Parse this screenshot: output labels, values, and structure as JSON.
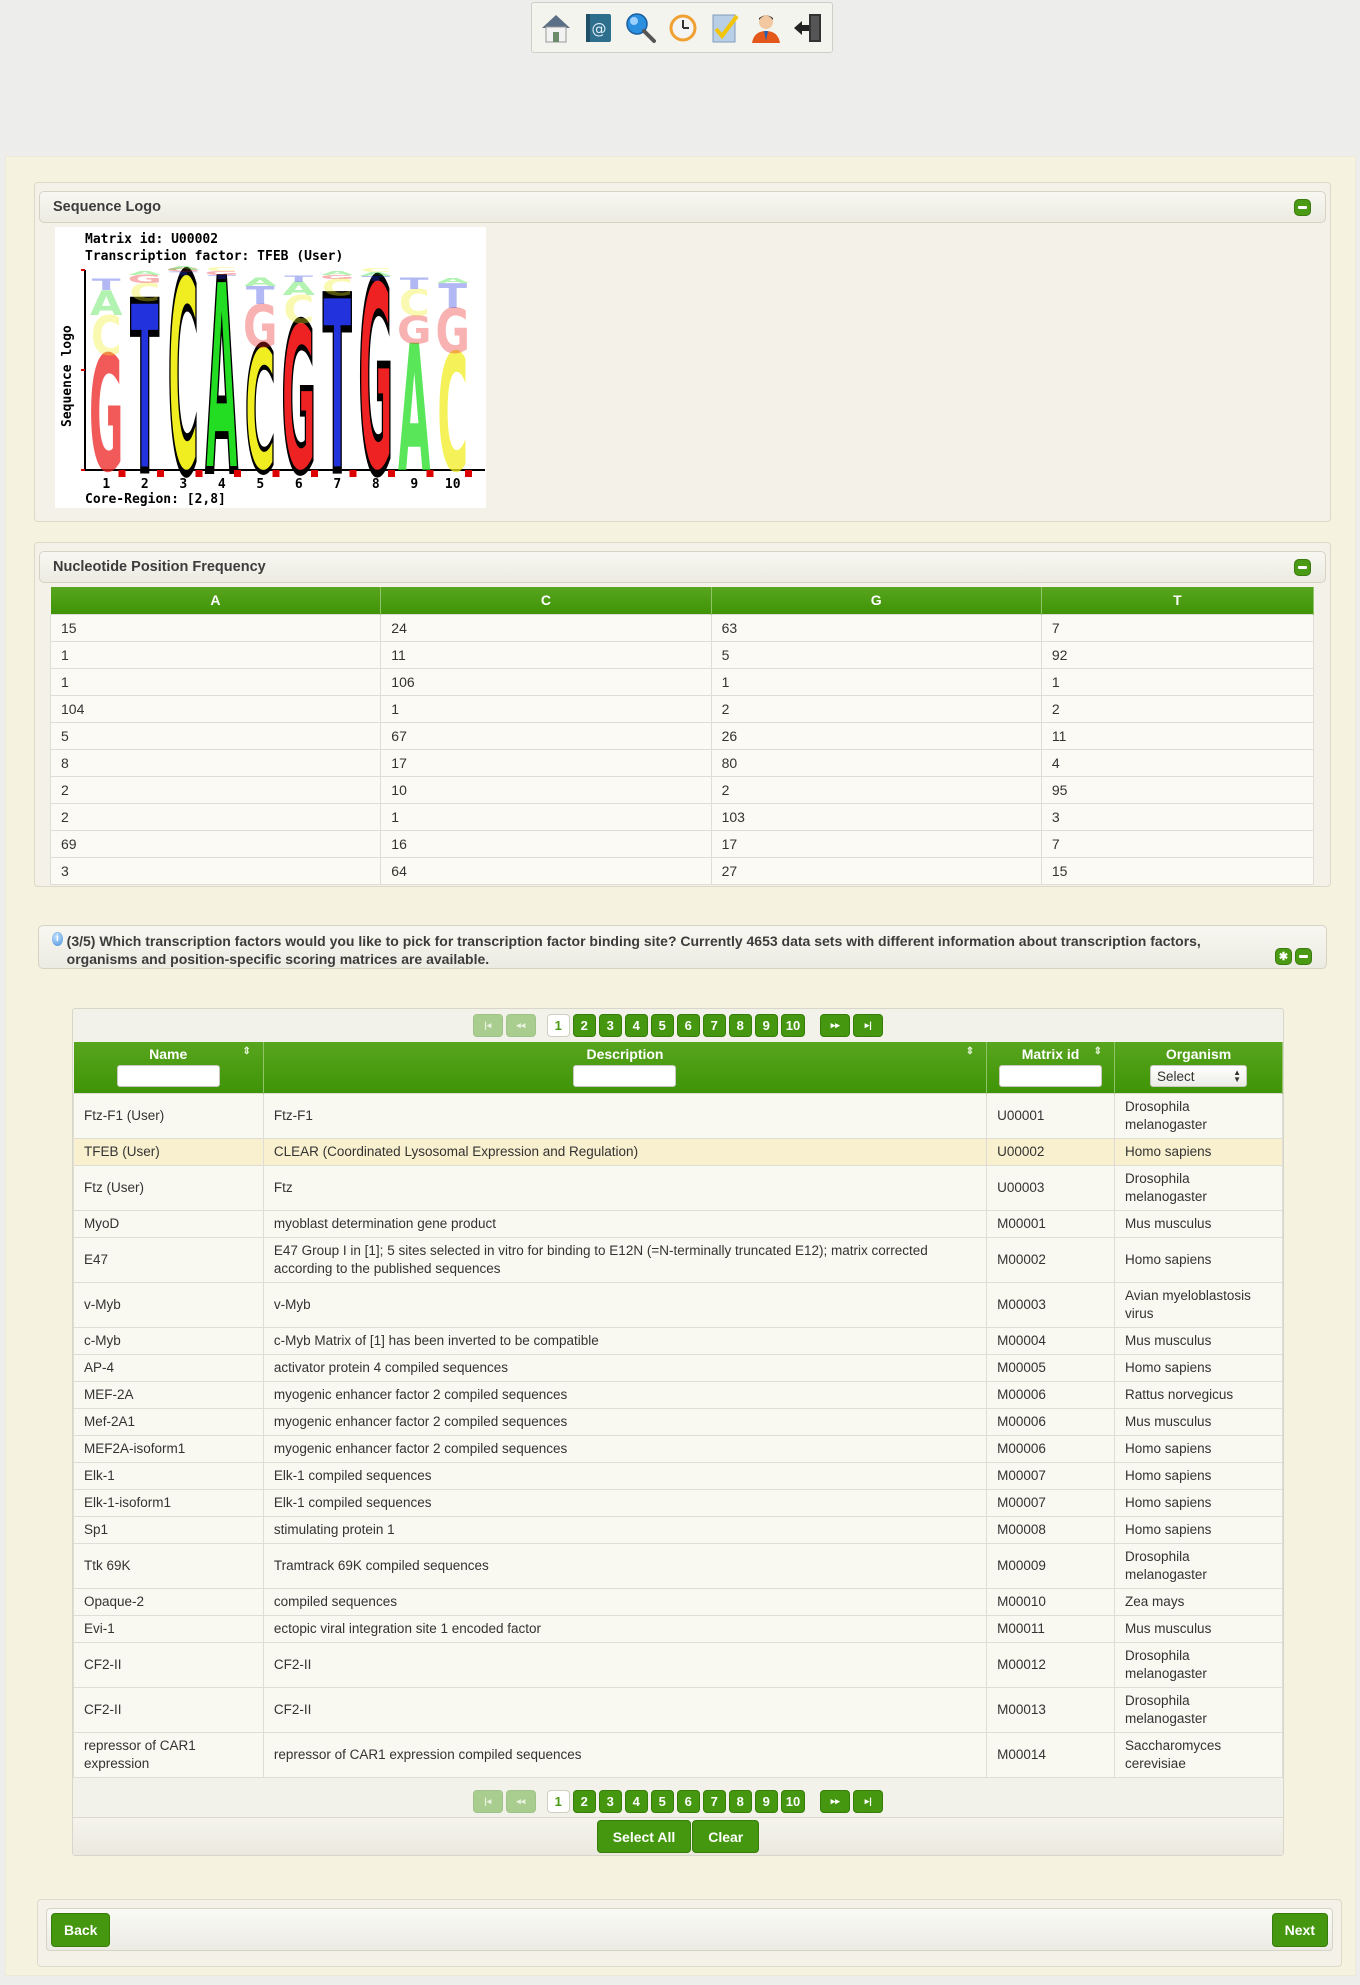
{
  "toolbar": {
    "icons": [
      "home-icon",
      "address-book-icon",
      "search-icon",
      "history-icon",
      "checklist-icon",
      "user-icon",
      "logout-icon"
    ]
  },
  "sequence_logo": {
    "title": "Sequence Logo",
    "matrix_id_line": "Matrix id: U00002",
    "tf_line": "Transcription factor: TFEB (User)",
    "y_label": "Sequence logo",
    "positions": [
      "1",
      "2",
      "3",
      "4",
      "5",
      "6",
      "7",
      "8",
      "9",
      "10"
    ],
    "core_region": "Core-Region: [2,8]",
    "consensus": [
      "G",
      "T",
      "C",
      "A",
      "C",
      "G",
      "T",
      "G",
      "A",
      "C"
    ]
  },
  "frequency": {
    "title": "Nucleotide Position Frequency",
    "headers": [
      "A",
      "C",
      "G",
      "T"
    ],
    "rows": [
      [
        "15",
        "24",
        "63",
        "7"
      ],
      [
        "1",
        "11",
        "5",
        "92"
      ],
      [
        "1",
        "106",
        "1",
        "1"
      ],
      [
        "104",
        "1",
        "2",
        "2"
      ],
      [
        "5",
        "67",
        "26",
        "11"
      ],
      [
        "8",
        "17",
        "80",
        "4"
      ],
      [
        "2",
        "10",
        "2",
        "95"
      ],
      [
        "2",
        "1",
        "103",
        "3"
      ],
      [
        "69",
        "16",
        "17",
        "7"
      ],
      [
        "3",
        "64",
        "27",
        "15"
      ]
    ]
  },
  "tf_panel": {
    "question": "(3/5) Which transcription factors would you like to pick for transcription factor binding site? Currently 4653 data sets with different information about transcription factors, organisms and position-specific scoring matrices are available.",
    "pager": {
      "first": "|◂",
      "prev": "◂◂",
      "pages": [
        "1",
        "2",
        "3",
        "4",
        "5",
        "6",
        "7",
        "8",
        "9",
        "10"
      ],
      "current": "1",
      "next": "▸▸",
      "last": "▸|"
    },
    "columns": {
      "name": "Name",
      "description": "Description",
      "matrix_id": "Matrix id",
      "organism": "Organism",
      "organism_select": "Select"
    },
    "rows": [
      {
        "name": "Ftz-F1 (User)",
        "description": "Ftz-F1",
        "matrix_id": "U00001",
        "organism": "Drosophila melanogaster"
      },
      {
        "name": "TFEB (User)",
        "description": "CLEAR (Coordinated Lysosomal Expression and Regulation)",
        "matrix_id": "U00002",
        "organism": "Homo sapiens",
        "highlighted": true
      },
      {
        "name": "Ftz (User)",
        "description": "Ftz",
        "matrix_id": "U00003",
        "organism": "Drosophila melanogaster"
      },
      {
        "name": "MyoD",
        "description": "myoblast determination gene product",
        "matrix_id": "M00001",
        "organism": "Mus musculus"
      },
      {
        "name": "E47",
        "description": "E47 Group I in [1]; 5 sites selected in vitro for binding to E12N (=N-terminally truncated E12); matrix corrected according to the published sequences",
        "matrix_id": "M00002",
        "organism": "Homo sapiens"
      },
      {
        "name": "v-Myb",
        "description": "v-Myb",
        "matrix_id": "M00003",
        "organism": "Avian myeloblastosis virus"
      },
      {
        "name": "c-Myb",
        "description": "c-Myb Matrix of [1] has been inverted to be compatible",
        "matrix_id": "M00004",
        "organism": "Mus musculus"
      },
      {
        "name": "AP-4",
        "description": "activator protein 4 compiled sequences",
        "matrix_id": "M00005",
        "organism": "Homo sapiens"
      },
      {
        "name": "MEF-2A",
        "description": "myogenic enhancer factor 2 compiled sequences",
        "matrix_id": "M00006",
        "organism": "Rattus norvegicus"
      },
      {
        "name": "Mef-2A1",
        "description": "myogenic enhancer factor 2 compiled sequences",
        "matrix_id": "M00006",
        "organism": "Mus musculus"
      },
      {
        "name": "MEF2A-isoform1",
        "description": "myogenic enhancer factor 2 compiled sequences",
        "matrix_id": "M00006",
        "organism": "Homo sapiens"
      },
      {
        "name": "Elk-1",
        "description": "Elk-1 compiled sequences",
        "matrix_id": "M00007",
        "organism": "Homo sapiens"
      },
      {
        "name": "Elk-1-isoform1",
        "description": "Elk-1 compiled sequences",
        "matrix_id": "M00007",
        "organism": "Homo sapiens"
      },
      {
        "name": "Sp1",
        "description": "stimulating protein 1",
        "matrix_id": "M00008",
        "organism": "Homo sapiens"
      },
      {
        "name": "Ttk 69K",
        "description": "Tramtrack 69K compiled sequences",
        "matrix_id": "M00009",
        "organism": "Drosophila melanogaster"
      },
      {
        "name": "Opaque-2",
        "description": "compiled sequences",
        "matrix_id": "M00010",
        "organism": "Zea mays"
      },
      {
        "name": "Evi-1",
        "description": "ectopic viral integration site 1 encoded factor",
        "matrix_id": "M00011",
        "organism": "Mus musculus"
      },
      {
        "name": "CF2-II",
        "description": "CF2-II",
        "matrix_id": "M00012",
        "organism": "Drosophila melanogaster"
      },
      {
        "name": "CF2-II",
        "description": "CF2-II",
        "matrix_id": "M00013",
        "organism": "Drosophila melanogaster"
      },
      {
        "name": "repressor of CAR1 expression",
        "description": "repressor of CAR1 expression compiled sequences",
        "matrix_id": "M00014",
        "organism": "Saccharomyces cerevisiae"
      }
    ],
    "select_all_label": "Select All",
    "clear_label": "Clear"
  },
  "footer": {
    "back_label": "Back",
    "next_label": "Next"
  },
  "colors": {
    "accent_green": "#44970e",
    "highlight_row": "#f9f0cf",
    "logo_A": "#22dd22",
    "logo_C": "#f0ee20",
    "logo_G": "#ee2222",
    "logo_T": "#2233dd"
  }
}
